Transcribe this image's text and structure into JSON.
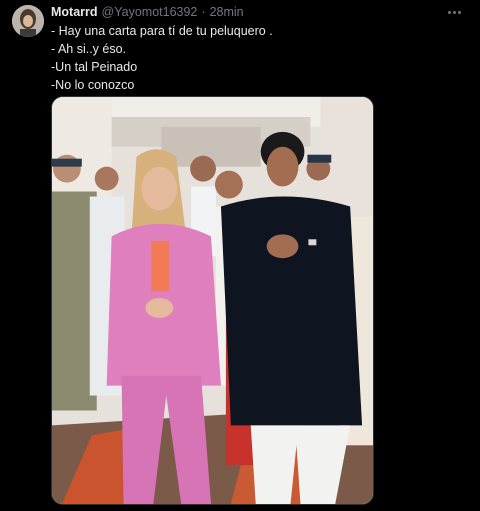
{
  "tweet": {
    "author_name": "Motarrd",
    "handle": "@Yayomot16392",
    "separator": "·",
    "time": "28min",
    "lines": [
      "- Hay una carta para tí de tu peluquero .",
      "- Ah si..y éso.",
      "-Un tal Peinado",
      "-No lo conozco"
    ]
  },
  "icons": {
    "avatar": "user-avatar",
    "more": "more-horizontal-icon"
  },
  "colors": {
    "background": "#000000",
    "text_primary": "#e7e9ea",
    "text_secondary": "#71767b",
    "media_border": "#2f3336"
  }
}
